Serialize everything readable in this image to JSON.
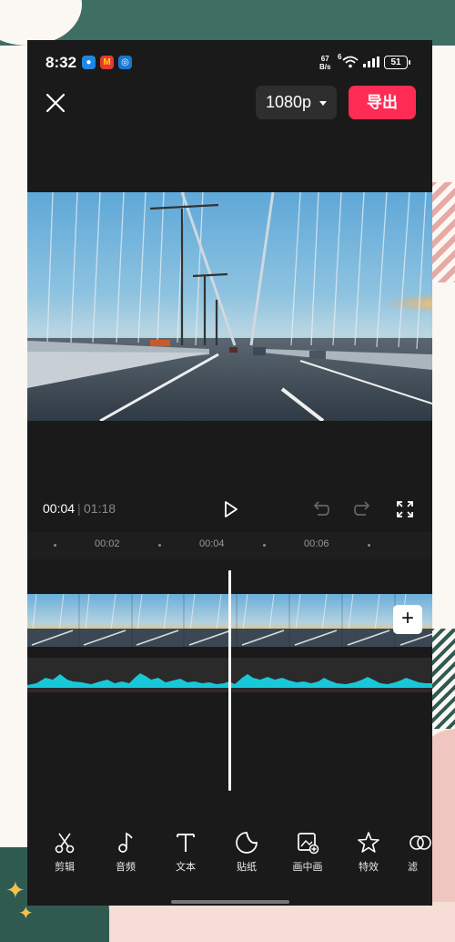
{
  "status_bar": {
    "time": "8:32",
    "net_speed_value": "67",
    "net_speed_unit": "B/s",
    "sim_label": "6",
    "battery": "51",
    "notification_icons": [
      "message-icon",
      "mcdonalds-icon",
      "browser-icon"
    ]
  },
  "header": {
    "close_icon": "close-icon",
    "resolution": "1080p",
    "export_label": "导出"
  },
  "playback": {
    "current_time": "00:04",
    "separator": "|",
    "total_time": "01:18",
    "play_icon": "play-icon",
    "undo_icon": "undo-icon",
    "redo_icon": "redo-icon",
    "fullscreen_icon": "fullscreen-icon"
  },
  "ruler": {
    "labels": [
      "00:02",
      "00:04",
      "00:06"
    ]
  },
  "timeline": {
    "add_clip_label": "+"
  },
  "toolbar": {
    "items": [
      {
        "label": "剪辑",
        "icon": "scissors-icon"
      },
      {
        "label": "音频",
        "icon": "music-note-icon"
      },
      {
        "label": "文本",
        "icon": "text-icon"
      },
      {
        "label": "贴纸",
        "icon": "sticker-icon"
      },
      {
        "label": "画中画",
        "icon": "picture-in-picture-icon"
      },
      {
        "label": "特效",
        "icon": "star-effect-icon"
      },
      {
        "label": "滤",
        "icon": "filter-icon"
      }
    ]
  },
  "colors": {
    "accent": "#fe2c55",
    "waveform": "#18c8d8",
    "background": "#1a1a1a"
  }
}
